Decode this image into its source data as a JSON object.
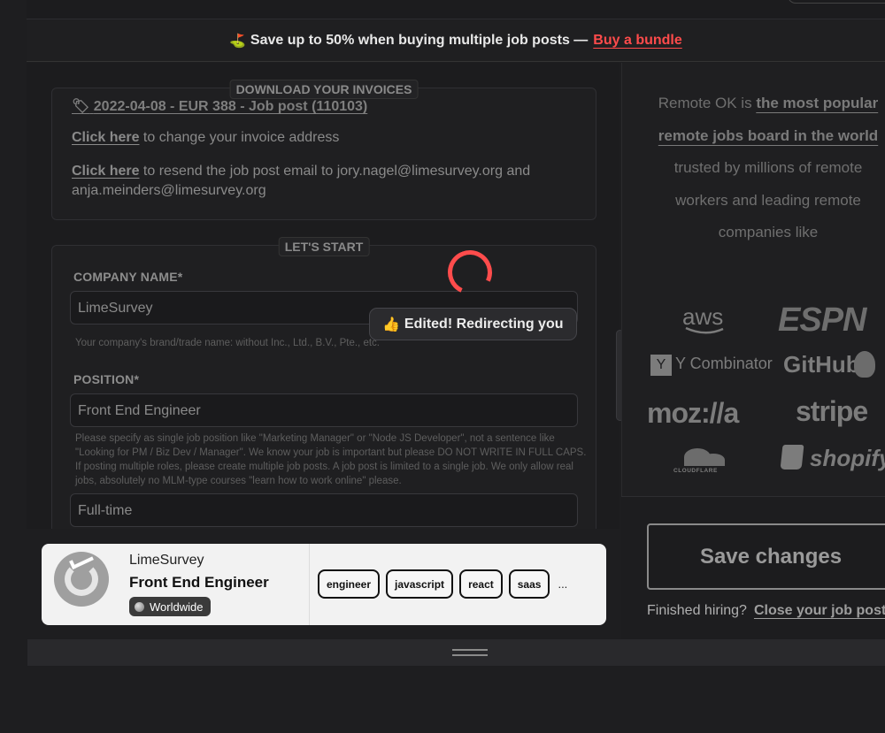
{
  "promo": {
    "flag": "⛳️",
    "text": "Save up to 50% when buying multiple job posts —",
    "link": "Buy a bundle"
  },
  "invoices": {
    "legend": "DOWNLOAD YOUR INVOICES",
    "invoice_icon": "🏷",
    "invoice_link": "2022-04-08 - EUR 388 - Job post (110103)",
    "address_link": "Click here",
    "address_text": " to change your invoice address",
    "resend_link": "Click here",
    "resend_text": " to resend the job post email to jory.nagel@limesurvey.org and anja.meinders@limesurvey.org"
  },
  "form": {
    "legend": "LET'S START",
    "company_label": "COMPANY NAME*",
    "company_value": "LimeSurvey",
    "company_hint": "Your company's brand/trade name: without Inc., Ltd., B.V., Pte., etc.",
    "position_label": "POSITION*",
    "position_value": "Front End Engineer",
    "position_hint": "Please specify as single job position like \"Marketing Manager\" or \"Node JS Developer\", not a sentence like \"Looking for PM / Biz Dev / Manager\". We know your job is important but please DO NOT WRITE IN FULL CAPS. If posting multiple roles, please create multiple job posts. A job post is limited to a single job. We only allow real jobs, absolutely no MLM-type courses \"learn how to work online\" please.",
    "type_value": "Full-time"
  },
  "toast": {
    "icon": "👍",
    "text": "Edited! Redirecting you"
  },
  "sidebar": {
    "tagline_pre": "Remote OK is ",
    "tagline_bold": "the most popular remote jobs board in the world",
    "tagline_post": " trusted by millions of remote workers and leading remote companies like",
    "logos": [
      "aws",
      "ESPN",
      "Y Combinator",
      "GitHub",
      "moz://a",
      "stripe",
      "CLOUDFLARE",
      "shopify"
    ]
  },
  "actions": {
    "save_label": "Save changes",
    "finished_text": "Finished hiring?",
    "close_link": "Close your job post"
  },
  "preview": {
    "company": "LimeSurvey",
    "position": "Front End Engineer",
    "location": "Worldwide",
    "tags": [
      "engineer",
      "javascript",
      "react",
      "saas"
    ],
    "more": "..."
  }
}
